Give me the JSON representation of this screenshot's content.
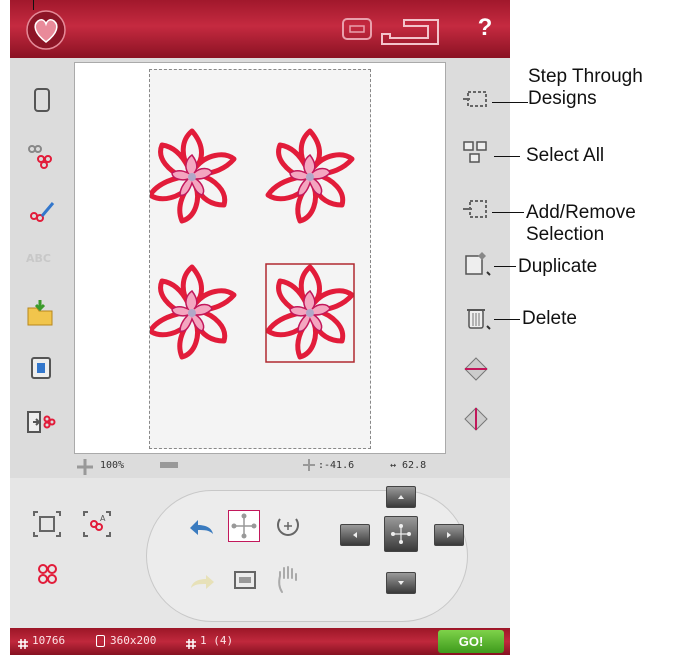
{
  "topbar": {
    "help_label": "?"
  },
  "canvas": {
    "zoom_label": "100%",
    "coord_x": ":-41.6",
    "coord_y": "↔ 62.8"
  },
  "statusbar": {
    "stitch_count": "10766",
    "hoop_size": "360x200",
    "design_count": "1 (4)",
    "go_label": "GO!"
  },
  "callouts": [
    {
      "id": "step-through",
      "lines": [
        "Step Through",
        "Designs"
      ]
    },
    {
      "id": "select-all",
      "lines": [
        "Select All"
      ]
    },
    {
      "id": "add-remove",
      "lines": [
        "Add/Remove",
        "Selection"
      ]
    },
    {
      "id": "duplicate",
      "lines": [
        "Duplicate"
      ]
    },
    {
      "id": "delete",
      "lines": [
        "Delete"
      ]
    }
  ],
  "colors": {
    "brand_red": "#b4213a",
    "flower_red": "#e21c3a",
    "go_green": "#5bb52c"
  },
  "icons": {
    "home": "heart-icon",
    "machine": "sewing-machine-icon",
    "help": "help-icon"
  }
}
